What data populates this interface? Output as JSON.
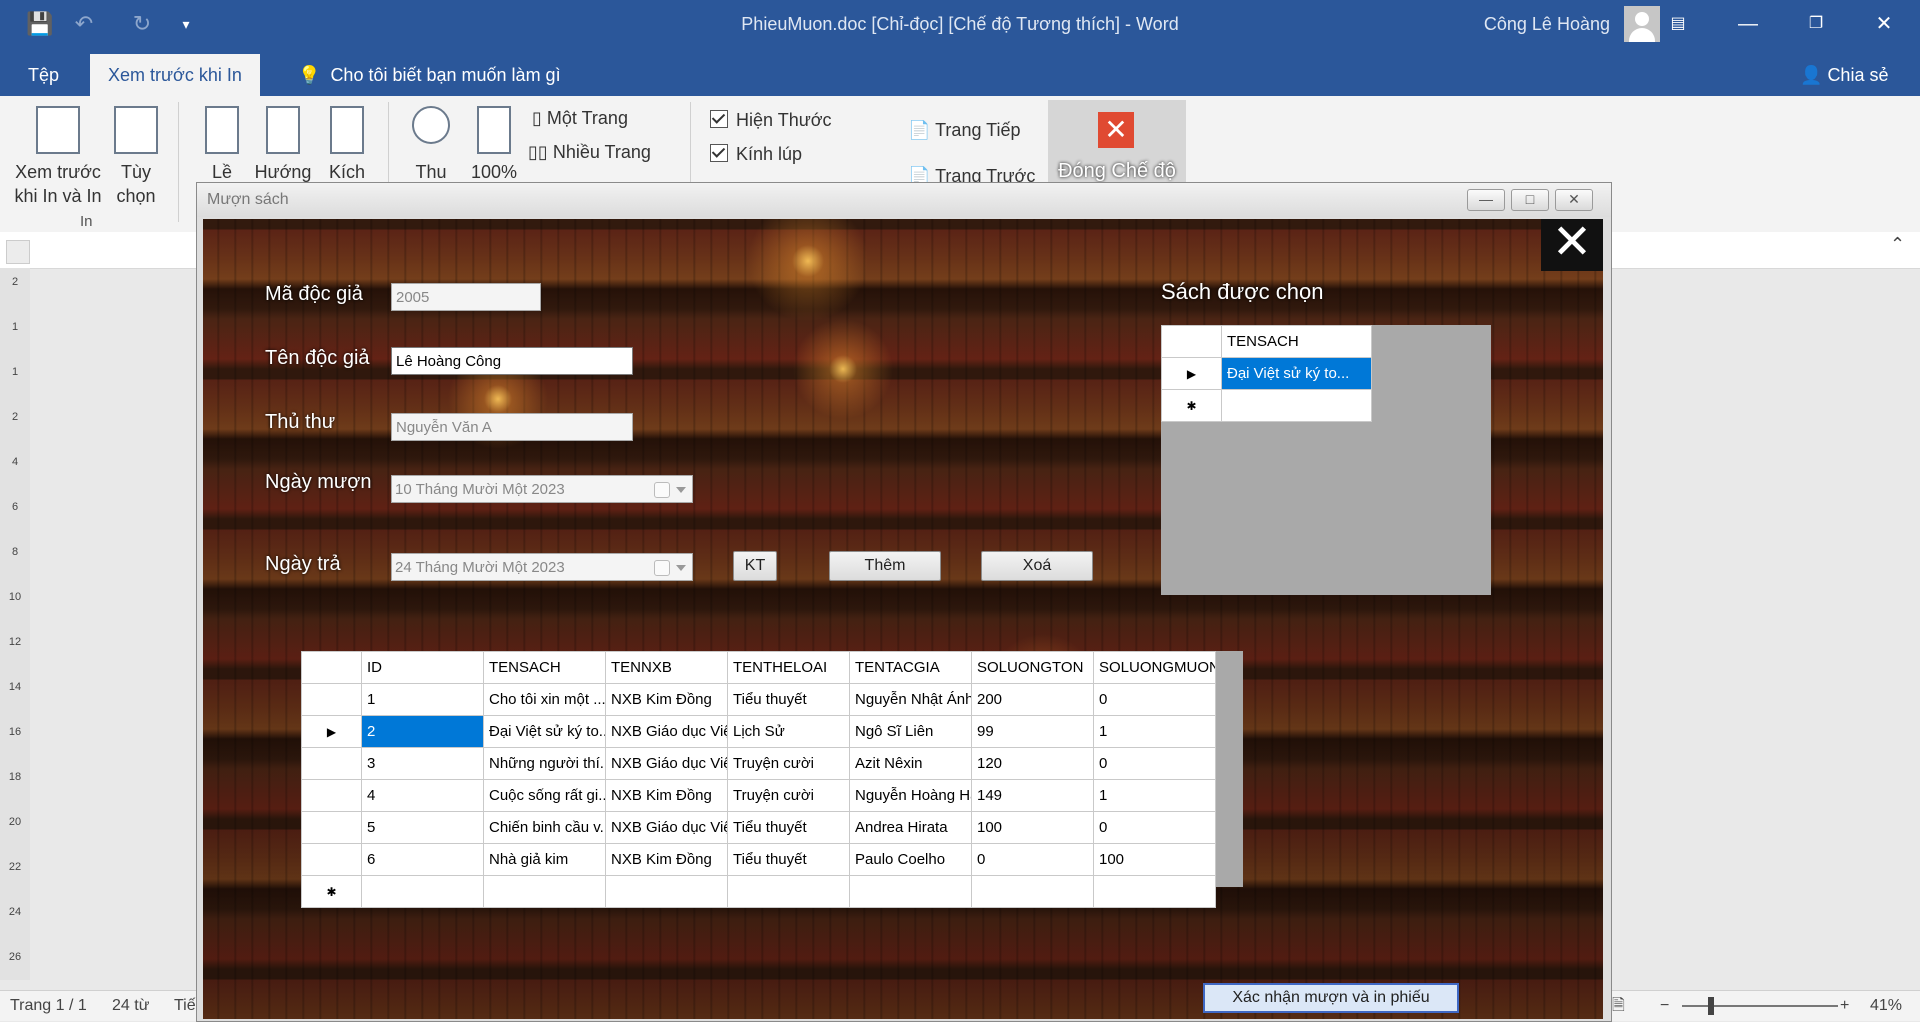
{
  "word": {
    "title": "PhieuMuon.doc [Chỉ-đọc] [Chế độ Tương thích]  -  Word",
    "user": "Công Lê Hoàng",
    "tabs": {
      "file": "Tệp",
      "print_preview": "Xem trước khi In",
      "tell_me": "Cho tôi biết bạn muốn làm gì",
      "share": "Chia sẻ"
    },
    "ribbon": {
      "print_preview_line1": "Xem trước",
      "print_preview_line2": "khi In và In",
      "options_line1": "Tùy",
      "options_line2": "chọn",
      "group_print": "In",
      "margins": "Lề",
      "orientation": "Hướng",
      "size": "Kích",
      "zoom": "Thu",
      "zoom100": "100%",
      "one_page": "Một Trang",
      "multi_page": "Nhiều Trang",
      "show_ruler": "Hiện Thước",
      "magnifier": "Kính lúp",
      "next_page": "Trang Tiếp",
      "prev_page": "Trang Trước",
      "close_preview": "Đóng Chế độ"
    },
    "ruler_marks": [
      "2",
      "1",
      "1",
      "2",
      "4",
      "6",
      "8",
      "10",
      "12",
      "14",
      "16",
      "18",
      "20",
      "22",
      "24",
      "26"
    ],
    "status": {
      "page": "Trang 1 / 1",
      "words": "24 từ",
      "extra": "Tiế",
      "zoom": "41%"
    }
  },
  "dialog": {
    "title": "Mượn sách",
    "labels": {
      "reader_id": "Mã độc giả",
      "reader_name": "Tên độc giả",
      "librarian": "Thủ thư",
      "borrow_date": "Ngày mượn",
      "return_date": "Ngày trả",
      "selected_books": "Sách được chọn"
    },
    "values": {
      "reader_id": "2005",
      "reader_name": "Lê Hoàng Công",
      "librarian": "Nguyễn Văn A",
      "borrow_date": "10 Tháng Mười Một 2023",
      "return_date": "24 Tháng Mười Một 2023"
    },
    "buttons": {
      "check": "KT",
      "add": "Thêm",
      "delete": "Xoá",
      "confirm": "Xác nhận mượn và in phiếu"
    },
    "selected_grid": {
      "header": "TENSACH",
      "rows": [
        "Đại Việt sử ký to..."
      ]
    },
    "books_grid": {
      "columns": [
        "ID",
        "TENSACH",
        "TENNXB",
        "TENTHELOAI",
        "TENTACGIA",
        "SOLUONGTON",
        "SOLUONGMUON"
      ],
      "rows": [
        [
          "1",
          "Cho tôi xin một ...",
          "NXB Kim Đồng",
          "Tiểu thuyết",
          "Nguyễn Nhật Ánh",
          "200",
          "0"
        ],
        [
          "2",
          "Đại Việt sử ký to...",
          "NXB Giáo dục Việ...",
          "Lịch Sử",
          "Ngô Sĩ Liên",
          "99",
          "1"
        ],
        [
          "3",
          "Những người thí...",
          "NXB Giáo dục Việ...",
          "Truyện cười",
          "Azit Nêxin",
          "120",
          "0"
        ],
        [
          "4",
          "Cuộc sống rất gi...",
          "NXB Kim Đồng",
          "Truyện cười",
          "Nguyễn Hoàng Hải",
          "149",
          "1"
        ],
        [
          "5",
          "Chiến binh cầu v...",
          "NXB Giáo dục Việ...",
          "Tiểu thuyết",
          "Andrea Hirata",
          "100",
          "0"
        ],
        [
          "6",
          "Nhà giả kim",
          "NXB Kim Đồng",
          "Tiểu thuyết",
          "Paulo Coelho",
          "0",
          "100"
        ]
      ],
      "selected_row": 1
    }
  },
  "colors": {
    "word_blue": "#2b579a",
    "selection": "#0078d7"
  }
}
